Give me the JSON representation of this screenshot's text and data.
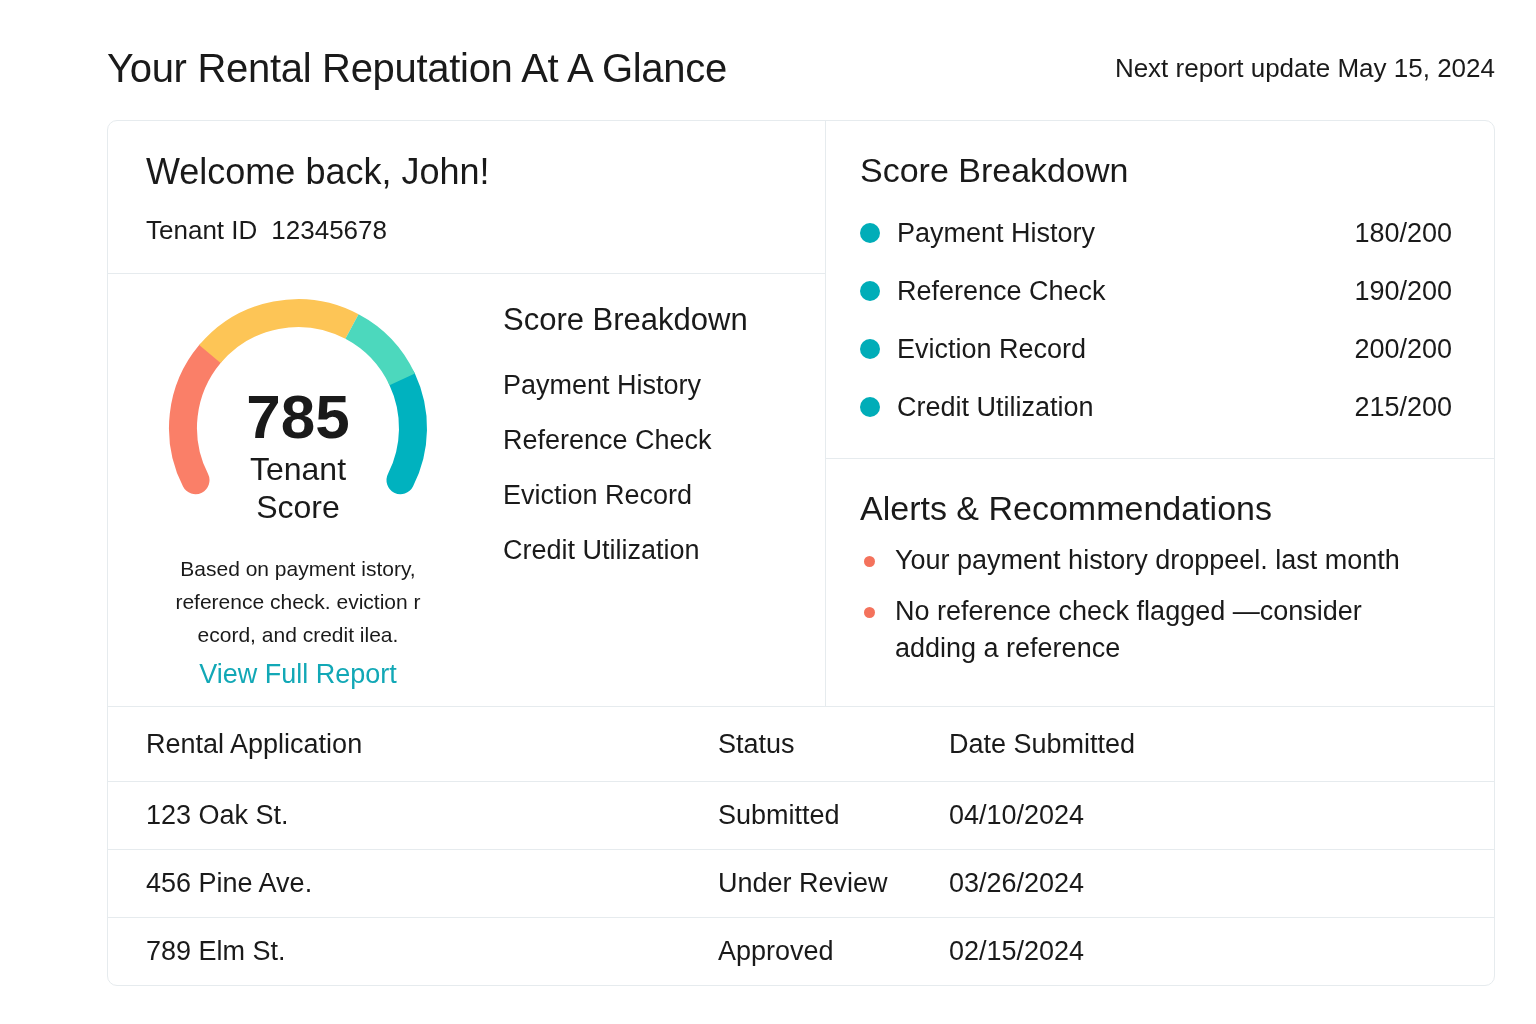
{
  "header": {
    "title": "Your Rental Reputation At A Glance",
    "next_update": "Next report update May 15, 2024"
  },
  "welcome": {
    "greeting": "Welcome back, John!",
    "tenant_id_label": "Tenant ID",
    "tenant_id": "12345678"
  },
  "score": {
    "value": "785",
    "label": "Tenant Score",
    "description": "Based on payment istory, reference check. eviction r ecord, and credit ilea.",
    "link": "View Full Report"
  },
  "summary_breakdown": {
    "title": "Score Breakdown",
    "items": [
      "Payment History",
      "Reference Check",
      "Eviction Record",
      "Credit Utilization"
    ]
  },
  "score_breakdown": {
    "title": "Score Breakdown",
    "items": [
      {
        "name": "Payment History",
        "score": "180/200",
        "color": "#00adb8"
      },
      {
        "name": "Reference Check",
        "score": "190/200",
        "color": "#00adb8"
      },
      {
        "name": "Eviction Record",
        "score": "200/200",
        "color": "#00adb8"
      },
      {
        "name": "Credit Utilization",
        "score": "215/200",
        "color": "#00adb8"
      }
    ]
  },
  "alerts": {
    "title": "Alerts & Recommendations",
    "items": [
      {
        "text": "Your payment history droppeel. last month",
        "color": "#f4725c"
      },
      {
        "text": "No reference check flagged —consider adding a reference",
        "color": "#f4725c"
      }
    ]
  },
  "table": {
    "columns": [
      "Rental Application",
      "Status",
      "Date Submitted"
    ],
    "rows": [
      [
        "123 Oak St.",
        "Submitted",
        "04/10/2024"
      ],
      [
        "456 Pine Ave.",
        "Under Review",
        "03/26/2024"
      ],
      [
        "789 Elm St.",
        "Approved",
        "02/15/2024"
      ]
    ]
  }
}
